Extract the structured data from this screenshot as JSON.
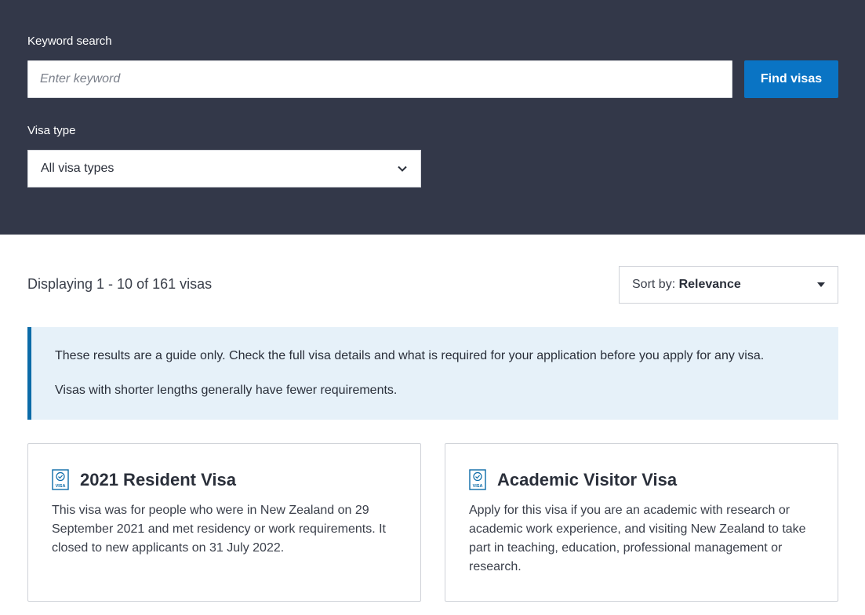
{
  "search": {
    "keyword_label": "Keyword search",
    "keyword_placeholder": "Enter keyword",
    "keyword_value": "",
    "find_button_label": "Find visas",
    "visa_type_label": "Visa type",
    "visa_type_value": "All visa types"
  },
  "results": {
    "count_text": "Displaying 1 - 10 of 161 visas",
    "sort_prefix": "Sort by: ",
    "sort_value": "Relevance"
  },
  "notice": {
    "line1": "These results are a guide only. Check the full visa details and what is required for your application before you apply for any visa.",
    "line2": "Visas with shorter lengths generally have fewer requirements."
  },
  "cards": [
    {
      "icon": "visa-icon",
      "icon_text": "VISA",
      "title": "2021 Resident Visa",
      "description": "This visa was for people who were in New Zealand on 29 September 2021 and met residency or work requirements. It closed to new applicants on 31 July 2022."
    },
    {
      "icon": "visa-icon",
      "icon_text": "VISA",
      "title": "Academic Visitor Visa",
      "description": "Apply for this visa if you are an academic with research or academic work experience, and visiting New Zealand to take part in teaching, education, professional management or research."
    }
  ],
  "colors": {
    "panel_bg": "#333849",
    "accent_button": "#0a74c4",
    "notice_bg": "#e6f1f9",
    "notice_border": "#0b6ba8"
  }
}
